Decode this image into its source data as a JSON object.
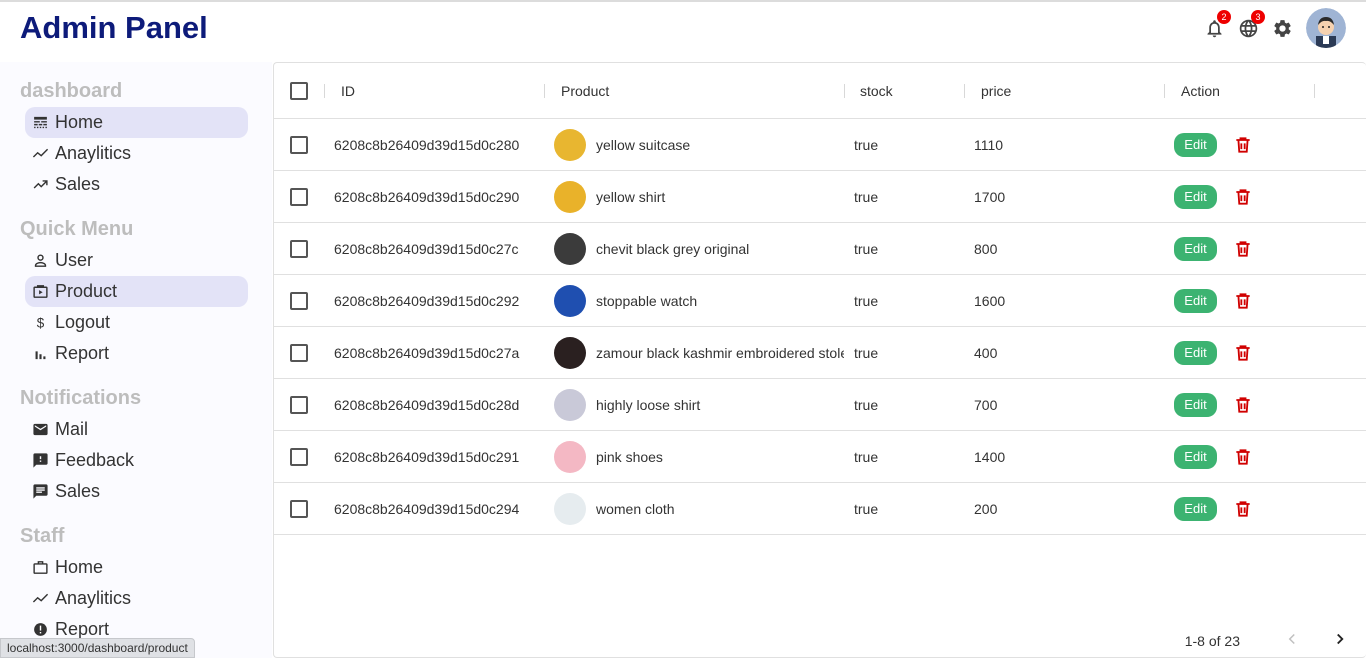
{
  "header": {
    "title": "Admin Panel",
    "notifications_count": "2",
    "language_count": "3"
  },
  "sidebar": {
    "sections": [
      {
        "title": "dashboard",
        "items": [
          {
            "label": "Home",
            "icon": "line-style-icon",
            "active": true
          },
          {
            "label": "Anaylitics",
            "icon": "timeline-icon"
          },
          {
            "label": "Sales",
            "icon": "trending-up-icon"
          }
        ]
      },
      {
        "title": "Quick Menu",
        "items": [
          {
            "label": "User",
            "icon": "person-outline-icon"
          },
          {
            "label": "Product",
            "icon": "storefront-icon",
            "active": true
          },
          {
            "label": "Logout",
            "icon": "dollar-icon"
          },
          {
            "label": "Report",
            "icon": "bar-chart-icon"
          }
        ]
      },
      {
        "title": "Notifications",
        "items": [
          {
            "label": "Mail",
            "icon": "mail-icon"
          },
          {
            "label": "Feedback",
            "icon": "feedback-icon"
          },
          {
            "label": "Sales",
            "icon": "chat-icon"
          }
        ]
      },
      {
        "title": "Staff",
        "items": [
          {
            "label": "Home",
            "icon": "work-outline-icon"
          },
          {
            "label": "Anaylitics",
            "icon": "timeline-icon"
          },
          {
            "label": "Report",
            "icon": "report-icon"
          }
        ]
      }
    ]
  },
  "table": {
    "columns": {
      "id": "ID",
      "product": "Product",
      "stock": "stock",
      "price": "price",
      "action": "Action"
    },
    "edit_label": "Edit",
    "rows": [
      {
        "id": "6208c8b26409d39d15d0c280",
        "product": "yellow suitcase",
        "stock": "true",
        "price": "1110",
        "img": "#e8b630"
      },
      {
        "id": "6208c8b26409d39d15d0c290",
        "product": "yellow shirt",
        "stock": "true",
        "price": "1700",
        "img": "#e9b22a"
      },
      {
        "id": "6208c8b26409d39d15d0c27c",
        "product": "chevit black grey original",
        "stock": "true",
        "price": "800",
        "img": "#3b3b3b"
      },
      {
        "id": "6208c8b26409d39d15d0c292",
        "product": "stoppable watch",
        "stock": "true",
        "price": "1600",
        "img": "#1f4fb0"
      },
      {
        "id": "6208c8b26409d39d15d0c27a",
        "product": "zamour black kashmir embroidered stole",
        "stock": "true",
        "price": "400",
        "img": "#2a2020"
      },
      {
        "id": "6208c8b26409d39d15d0c28d",
        "product": "highly loose shirt",
        "stock": "true",
        "price": "700",
        "img": "#c9c9d8"
      },
      {
        "id": "6208c8b26409d39d15d0c291",
        "product": "pink shoes",
        "stock": "true",
        "price": "1400",
        "img": "#f4b8c4"
      },
      {
        "id": "6208c8b26409d39d15d0c294",
        "product": "women cloth",
        "stock": "true",
        "price": "200",
        "img": "#e6ecef"
      }
    ],
    "pagination": "1-8 of 23"
  },
  "statusbar": {
    "url": "localhost:3000/dashboard/product"
  },
  "colors": {
    "brand": "#0d1b7a",
    "edit": "#3cb371",
    "delete": "#d00000",
    "active_item": "#e3e3f7"
  }
}
